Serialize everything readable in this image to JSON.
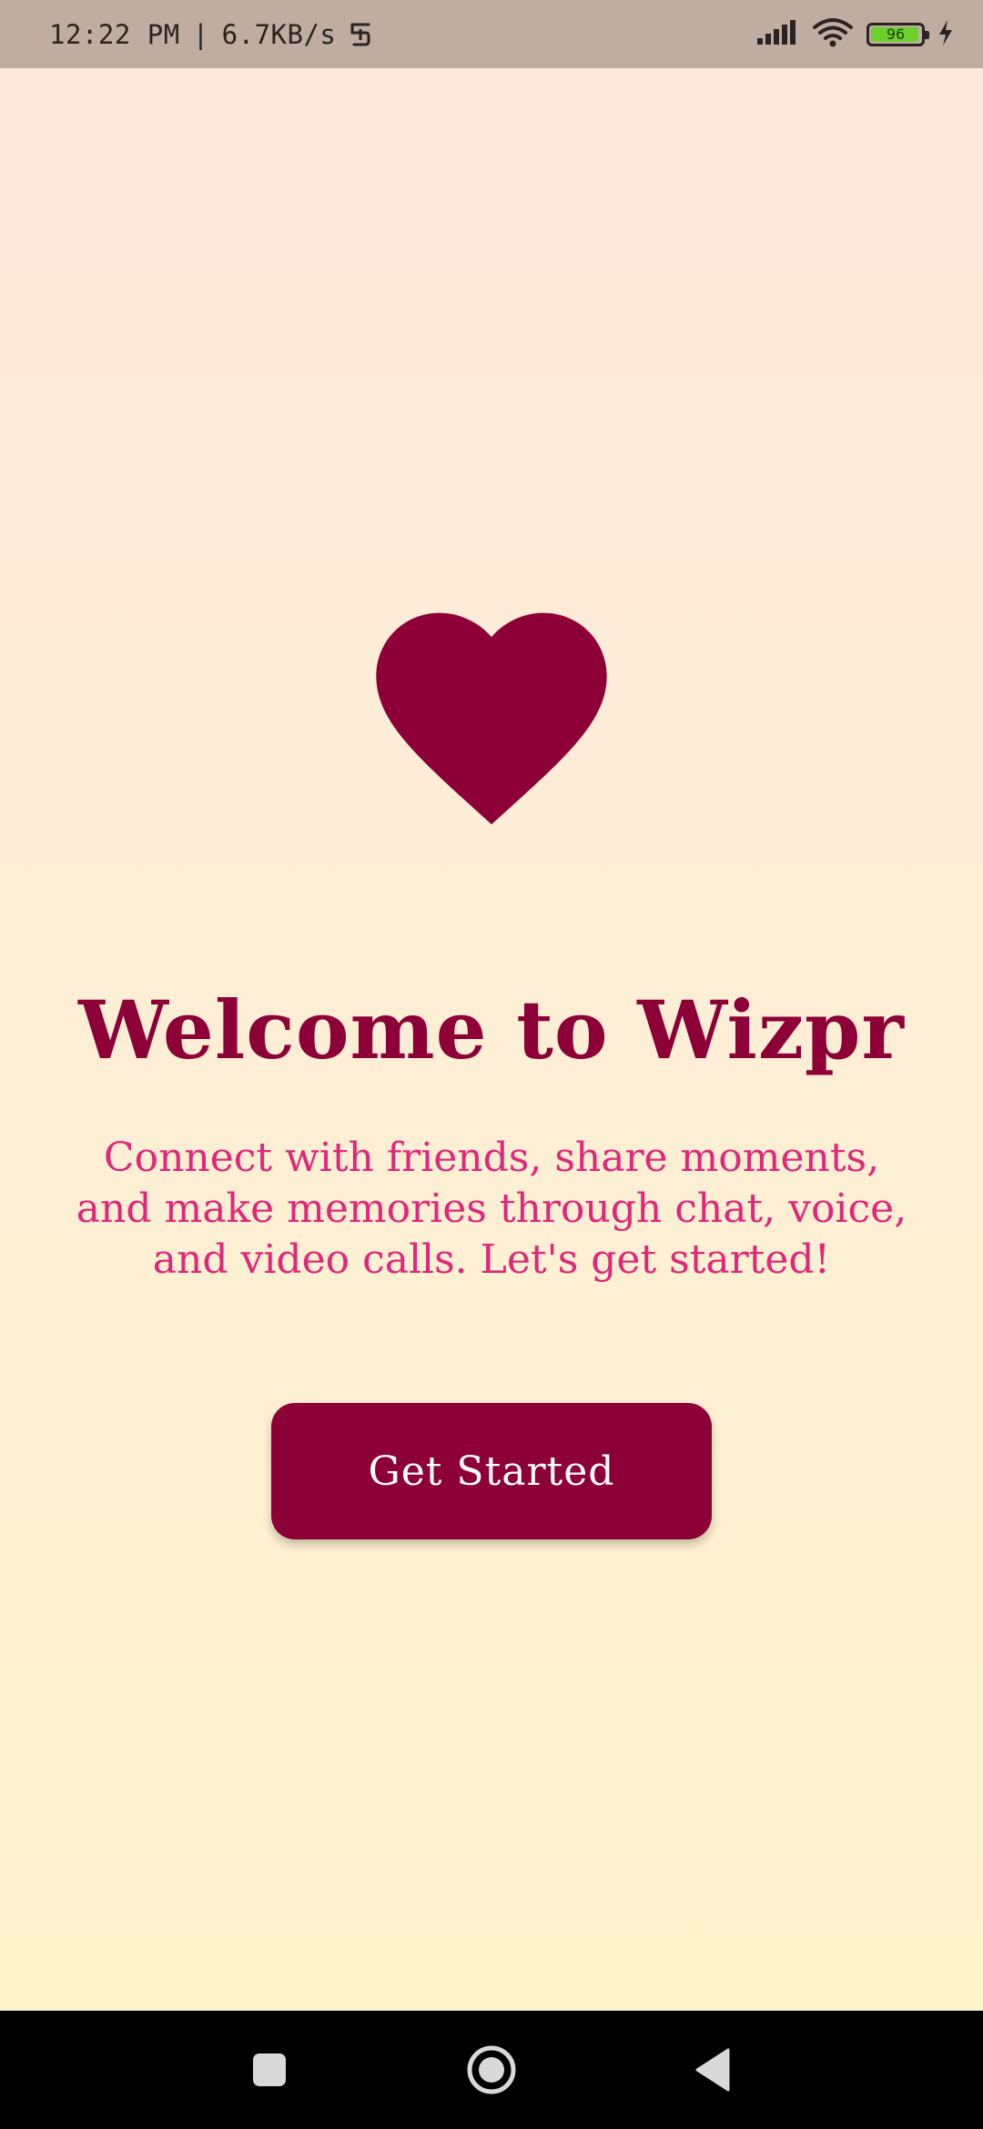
{
  "status_bar": {
    "time": "12:22 PM",
    "separator": "|",
    "network_speed": "6.7KB/s",
    "battery_level": "96",
    "battery_fraction": 0.96,
    "icons": [
      "data-saver-icon",
      "signal-icon",
      "wifi-icon",
      "battery-icon",
      "charging-icon"
    ]
  },
  "welcome": {
    "logo_icon": "heart-icon",
    "title": "Welcome to Wizpr",
    "description": "Connect with friends, share moments, and make memories through chat, voice, and video calls. Let's get started!",
    "button_label": "Get Started"
  },
  "navigation_bar": {
    "buttons": [
      "recent-apps",
      "home",
      "back"
    ]
  },
  "colors": {
    "brand": "#8c0037",
    "accent_text": "#e0277a",
    "background_top": "#fde7dc",
    "background_bottom": "#fdf3cc",
    "status_bar": "#c0ada2",
    "battery_fill": "#6bd12a"
  }
}
